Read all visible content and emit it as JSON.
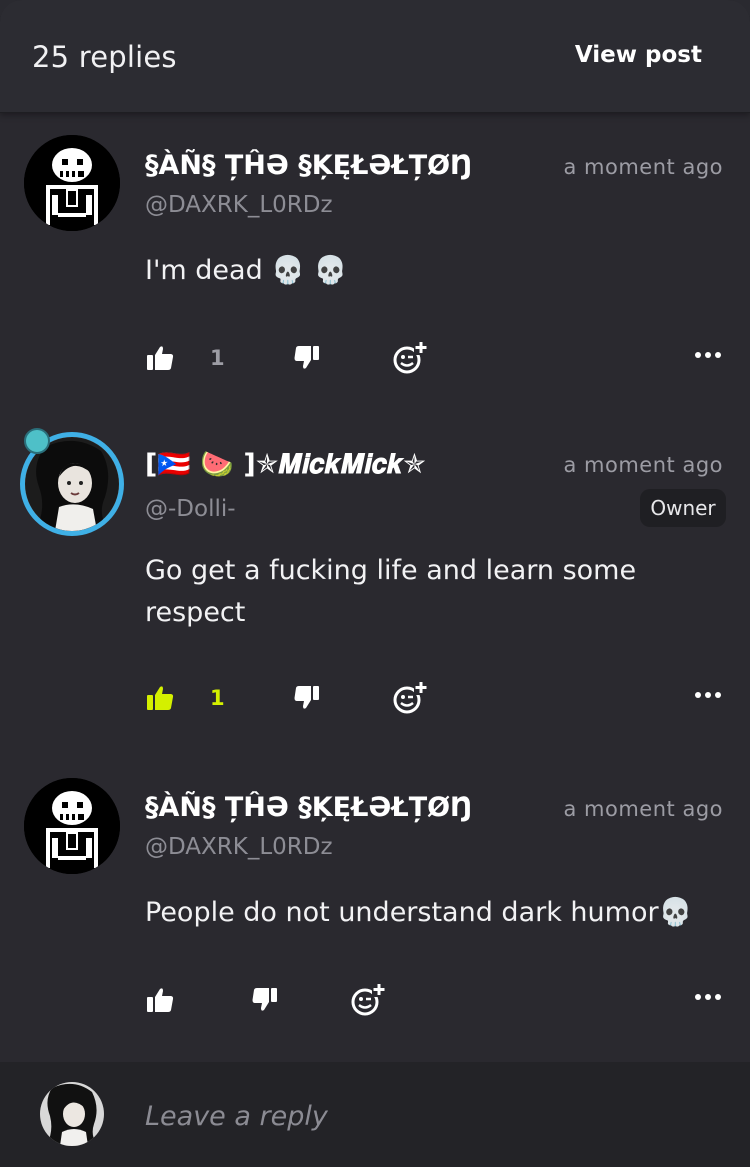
{
  "header": {
    "reply_count": "25 replies",
    "view_post_label": "View post"
  },
  "comments": [
    {
      "display_name": "§ÀÑ§ ȚĤƏ §ĶĘŁƏŁȚØŊ",
      "handle": "@DAXRK_L0RDz",
      "timestamp": "a moment ago",
      "text": "I'm dead 💀 💀",
      "like_count": "1",
      "liked": false
    },
    {
      "display_name": "[🇵🇷 🍉 ]✯𝑴𝒊𝒄𝒌𝑴𝒊𝒄𝒌✯",
      "handle": "@-Dolli-",
      "timestamp": "a moment ago",
      "badge": "Owner",
      "text": "Go get a fucking life and learn some respect",
      "like_count": "1",
      "liked": true
    },
    {
      "display_name": "§ÀÑ§ ȚĤƏ §ĶĘŁƏŁȚØŊ",
      "handle": "@DAXRK_L0RDz",
      "timestamp": "a moment ago",
      "text": "People do not understand dark humor💀",
      "like_count": "",
      "liked": false
    }
  ],
  "footer": {
    "reply_placeholder": "Leave a reply"
  },
  "colors": {
    "background": "#2a292f",
    "liked_accent": "#d4f000",
    "avatar_ring": "#3fb0e6"
  }
}
